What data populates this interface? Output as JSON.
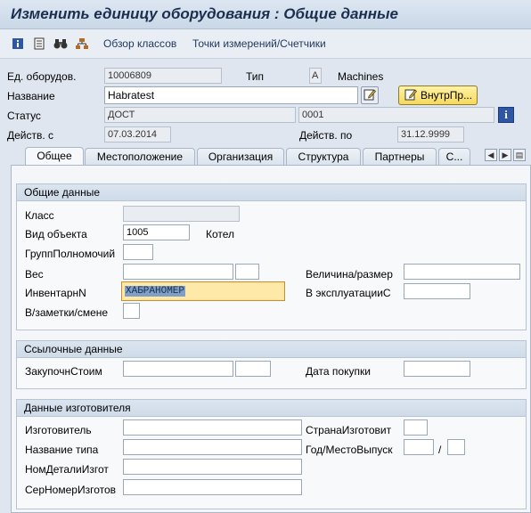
{
  "window": {
    "title": "Изменить единицу оборудования : Общие данные"
  },
  "toolbar": {
    "icons": [
      "info-icon",
      "document-icon",
      "binoculars-icon",
      "hierarchy-icon"
    ],
    "classes_label": "Обзор классов",
    "measure_label": "Точки измерений/Счетчики"
  },
  "header": {
    "equipment_label": "Ед. оборудов.",
    "equipment_value": "10006809",
    "type_label": "Тип",
    "type_value": "A",
    "type_text": "Machines",
    "name_label": "Название",
    "name_value": "Habratest",
    "internal_button_label": "ВнутрПр...",
    "status_label": "Статус",
    "status_value": "ДОСТ",
    "status_code_value": "0001",
    "valid_from_label": "Действ. с",
    "valid_from_value": "07.03.2014",
    "valid_to_label": "Действ. по",
    "valid_to_value": "31.12.9999"
  },
  "tabs": [
    {
      "label": "Общее"
    },
    {
      "label": "Местоположение"
    },
    {
      "label": "Организация"
    },
    {
      "label": "Структура"
    },
    {
      "label": "Партнеры"
    },
    {
      "label": "С..."
    }
  ],
  "general": {
    "title": "Общие данные",
    "class_label": "Класс",
    "class_value": "",
    "object_type_label": "Вид объекта",
    "object_type_value": "1005",
    "object_type_text": "Котел",
    "auth_group_label": "ГруппПолномочий",
    "weight_label": "Вес",
    "size_label": "Величина/размер",
    "inventory_label": "ИнвентарнN",
    "inventory_value": "ХАБРАНОМЕР",
    "in_service_label": "В эксплуатацииС",
    "notes_label": "В/заметки/смене"
  },
  "reference": {
    "title": "Ссылочные данные",
    "acquisition_value_label": "ЗакупочнСтоим",
    "purchase_date_label": "Дата покупки"
  },
  "manufacturer": {
    "title": "Данные изготовителя",
    "manufacturer_label": "Изготовитель",
    "country_label": "СтранаИзготовит",
    "model_label": "Название типа",
    "year_label": "Год/МестоВыпуск",
    "slash": "/",
    "part_number_label": "НомДеталиИзгот",
    "serial_label": "СерНомерИзготов"
  }
}
